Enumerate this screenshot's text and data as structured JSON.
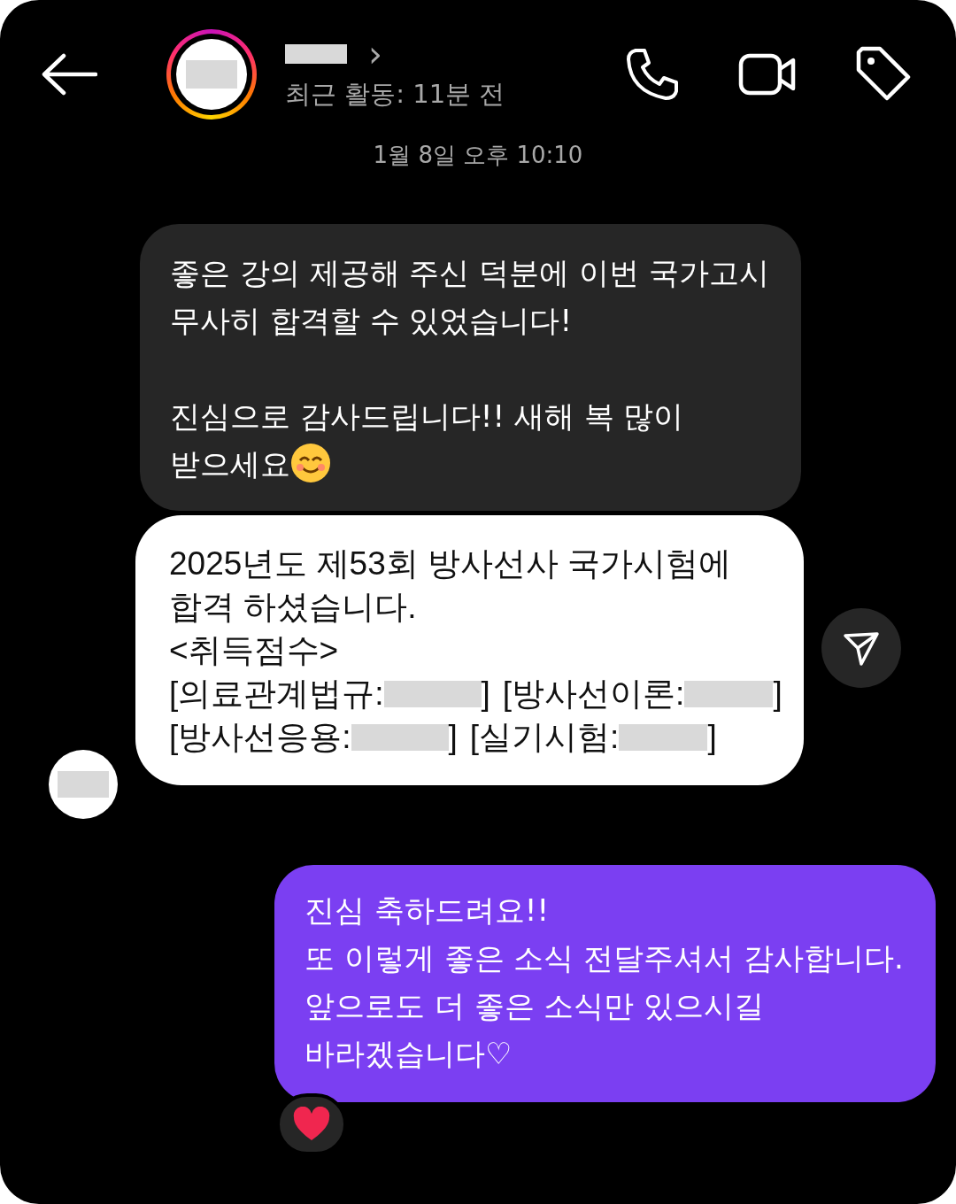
{
  "header": {
    "status": "최근 활동: 11분 전",
    "chevron": "›"
  },
  "timestamp": "1월 8일 오후 10:10",
  "messages": [
    {
      "kind": "received",
      "text": "좋은 강의 제공해 주신 덕분에 이번 국가고시\n무사히 합격할 수 있었습니다!\n\n진심으로 감사드립니다!! 새해 복 많이\n받으세요",
      "emoji": true
    },
    {
      "kind": "card",
      "lines": [
        "2025년도 제53회 방사선사 국가시험에",
        "합격 하셨습니다.",
        "<취득점수>"
      ],
      "scores": [
        [
          {
            "label": "[의료관계법규:",
            "close": "]"
          },
          {
            "label": "[방사선이론:",
            "close": "]"
          }
        ],
        [
          {
            "label": "[방사선응용:",
            "close": "]"
          },
          {
            "label": "[실기시험:",
            "close": "]"
          }
        ]
      ]
    },
    {
      "kind": "sent",
      "text": "진심 축하드려요!!\n또 이렇게 좋은 소식 전달주셔서 감사합니다.\n앞으로도 더 좋은 소식만 있으시길\n바라겠습니다♡",
      "reaction": true
    }
  ]
}
